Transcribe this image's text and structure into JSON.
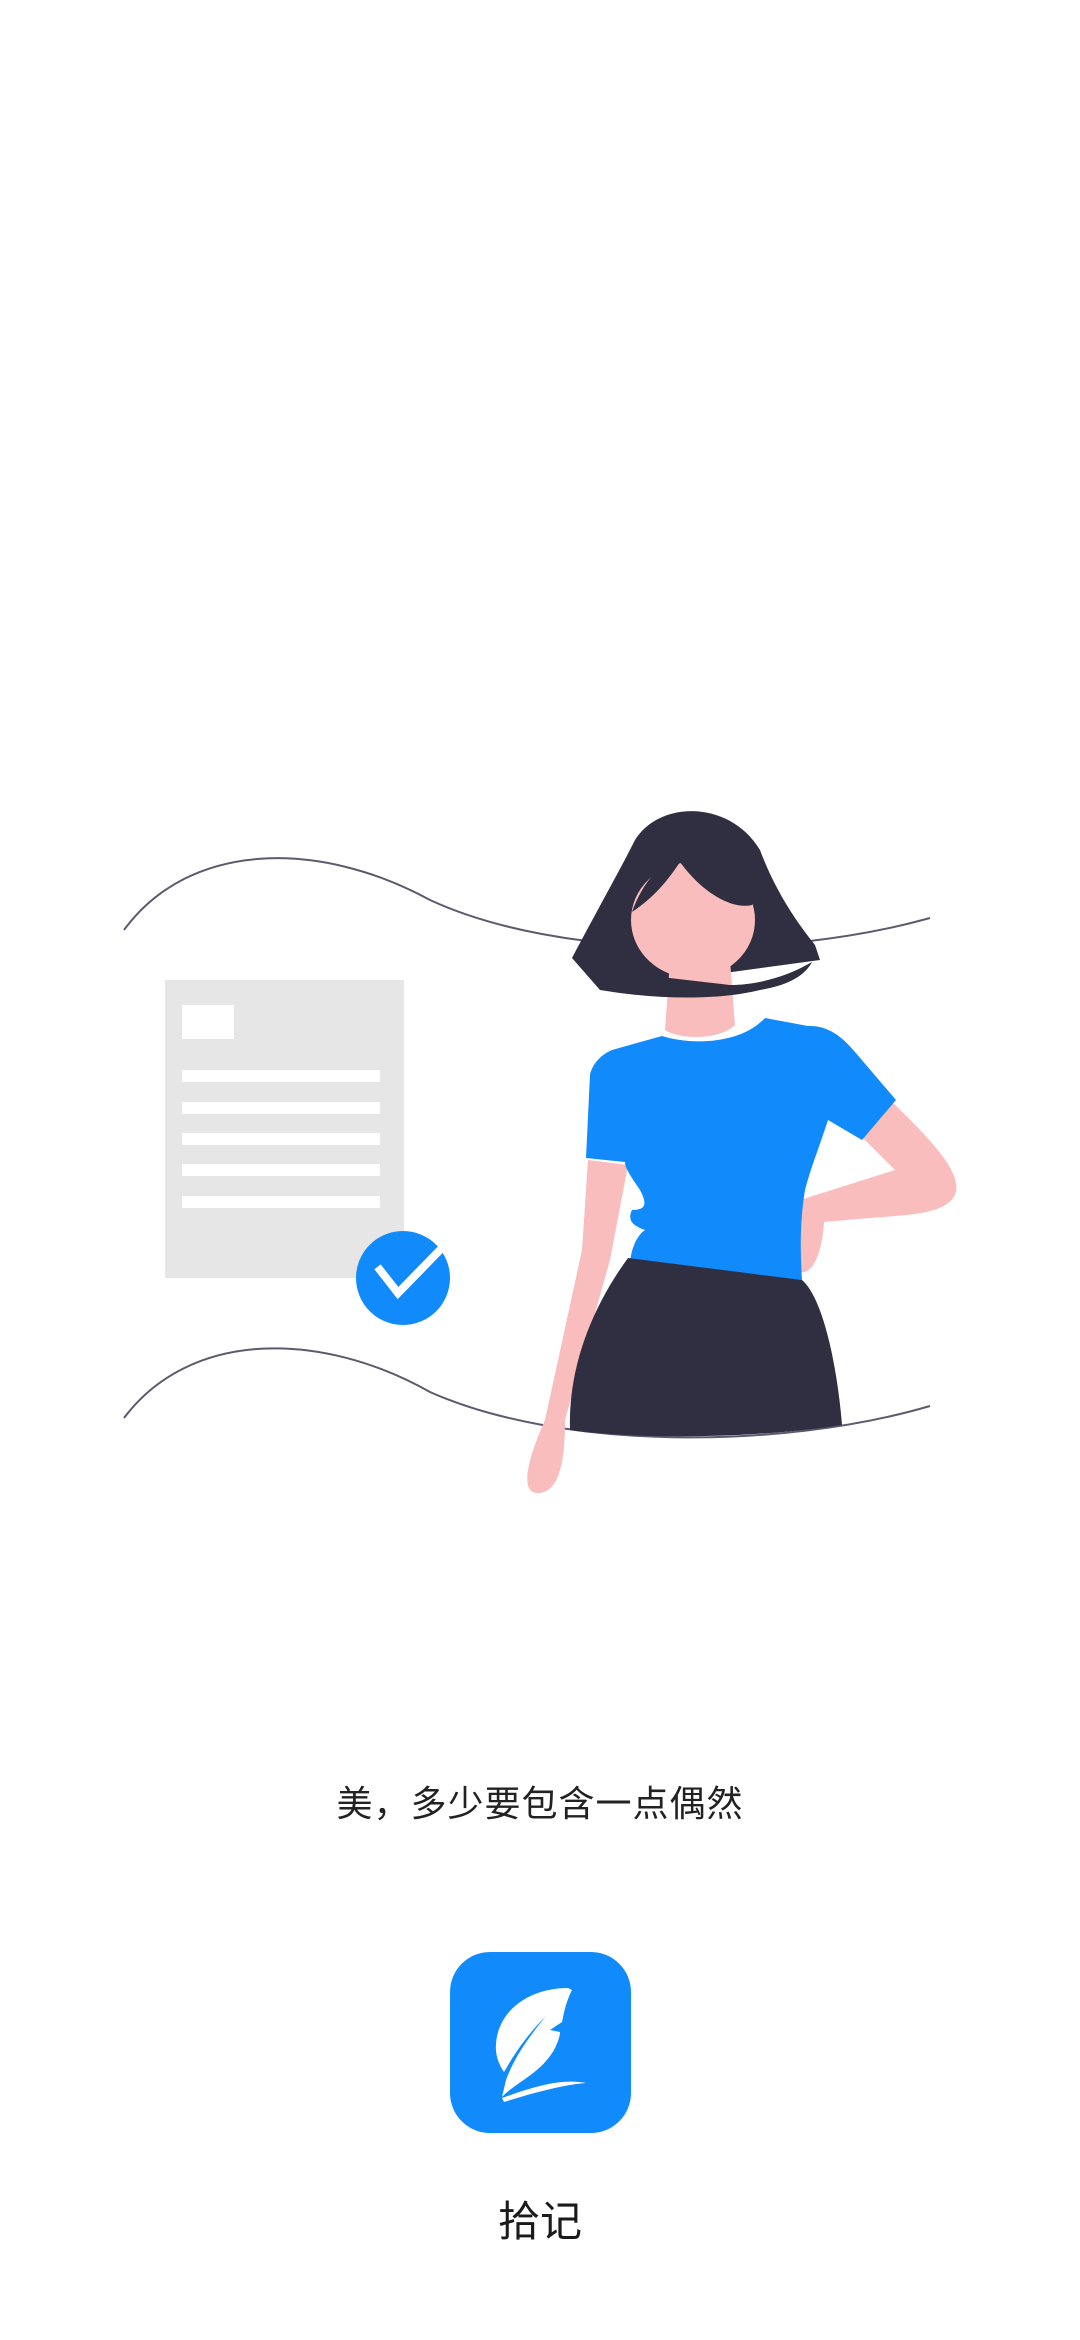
{
  "splash": {
    "slogan": "美，多少要包含一点偶然",
    "app_name": "拾记"
  },
  "icons": {
    "app_logo": "feather-quill-icon",
    "check": "check-circle-icon"
  },
  "colors": {
    "background": "#ffffff",
    "brand_blue": "#118bfc",
    "skin": "#f9bdbd",
    "dark": "#302f42",
    "doc_gray": "#e6e6e6",
    "line": "#5b5a6e",
    "text": "#222222"
  }
}
